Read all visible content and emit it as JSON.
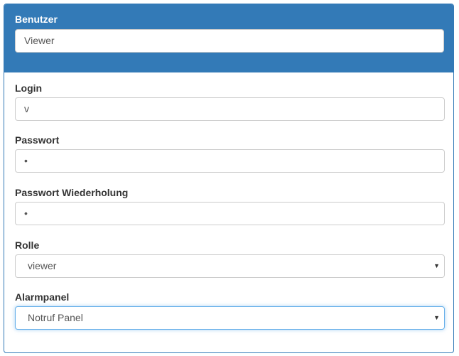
{
  "header": {
    "label": "Benutzer",
    "value": "Viewer"
  },
  "fields": {
    "login": {
      "label": "Login",
      "value": "v"
    },
    "password": {
      "label": "Passwort",
      "value": "•"
    },
    "password_repeat": {
      "label": "Passwort Wiederholung",
      "value": "•"
    },
    "role": {
      "label": "Rolle",
      "value": "viewer"
    },
    "alarm_panel": {
      "label": "Alarmpanel",
      "value": "Notruf Panel"
    }
  },
  "icons": {
    "dropdown": "chevron-down-icon"
  },
  "colors": {
    "primary": "#337ab7",
    "focus": "#66afe9"
  }
}
